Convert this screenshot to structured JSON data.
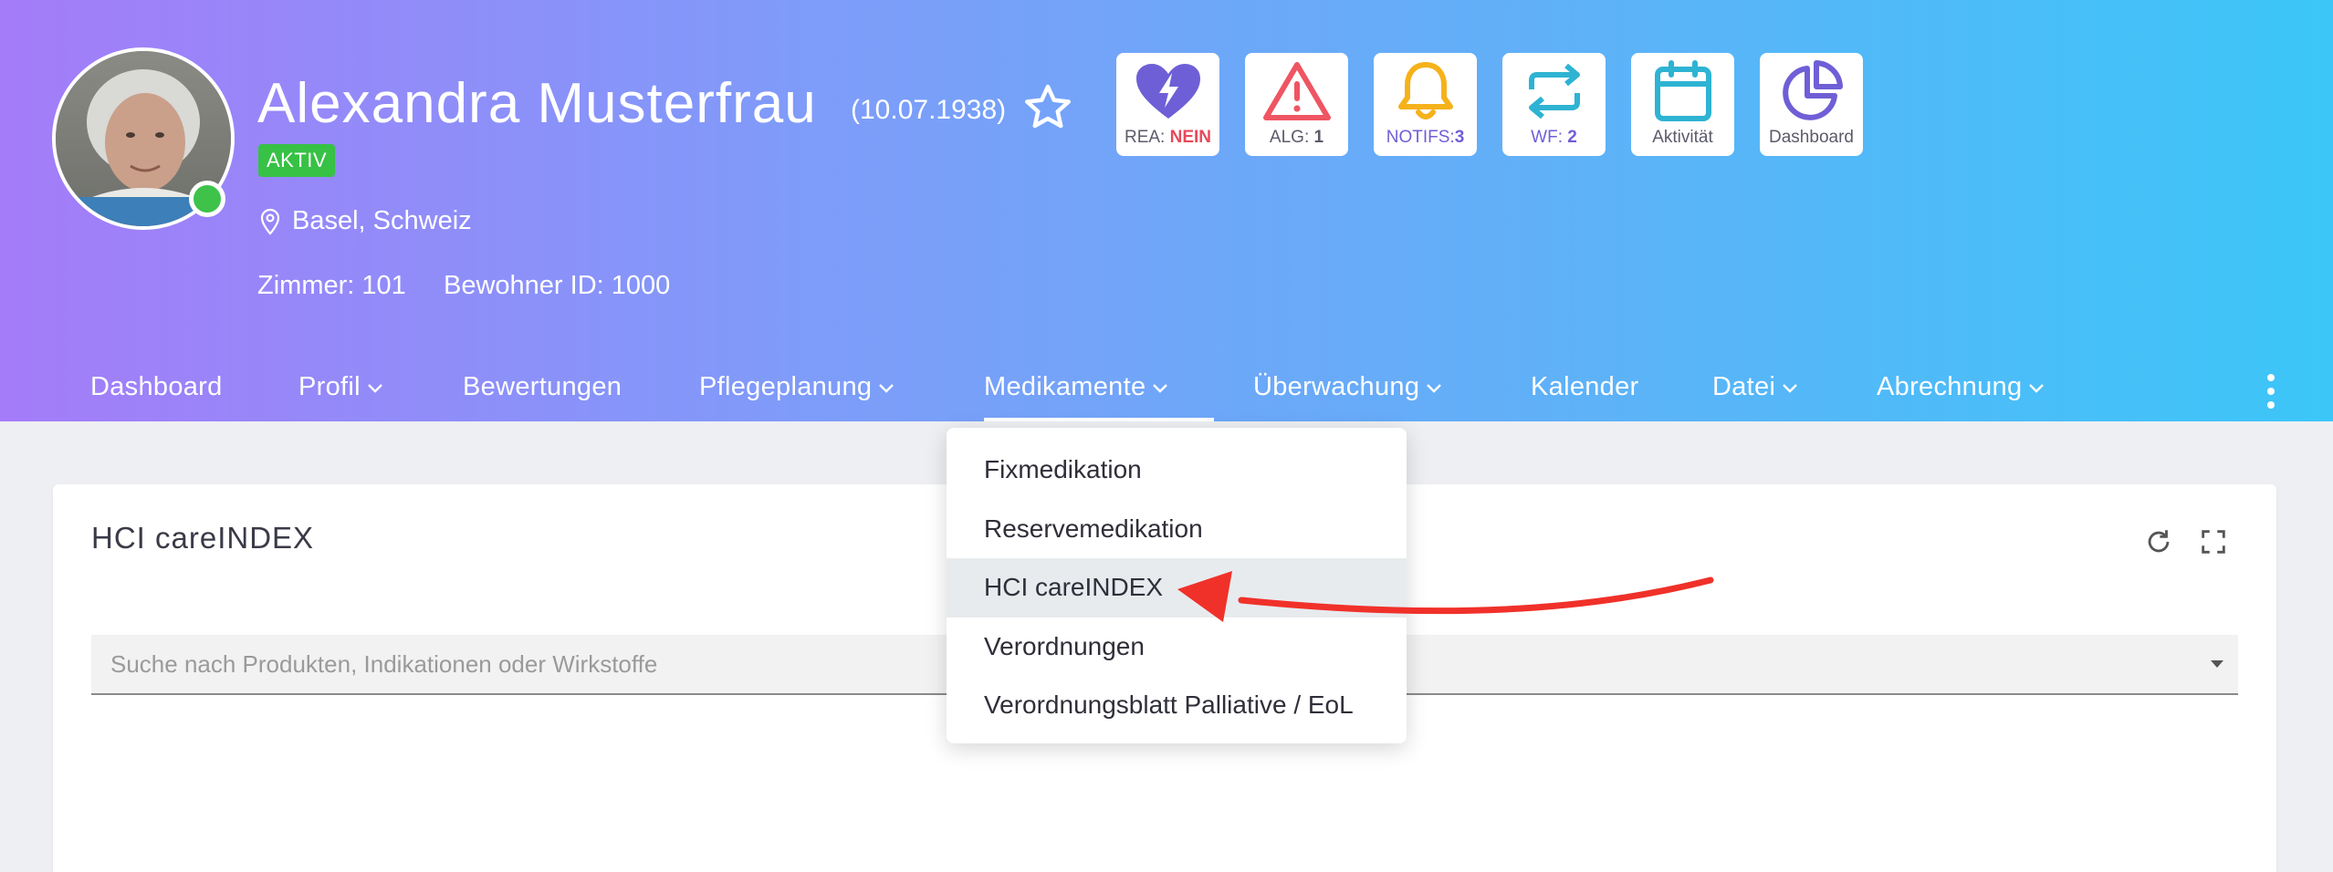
{
  "patient": {
    "name": "Alexandra Musterfrau",
    "dob": "(10.07.1938)",
    "status": "AKTIV",
    "location": "Basel, Schweiz",
    "room": "Zimmer: 101",
    "resident_id": "Bewohner ID: 1000"
  },
  "tiles": [
    {
      "icon": "heart-bolt-icon",
      "label_prefix": "REA: ",
      "label_value": "NEIN",
      "icon_color": "#6f5fd6",
      "value_color": "#e64a5a"
    },
    {
      "icon": "warning-triangle-icon",
      "label_prefix": "ALG: ",
      "label_value": "1",
      "icon_color": "#ef5563",
      "value_color": "#5b5b6b"
    },
    {
      "icon": "bell-icon",
      "label_prefix": "NOTIFS:",
      "label_value": "3",
      "icon_color": "#f6b21b",
      "value_color": "#6f5fd6"
    },
    {
      "icon": "repeat-arrows-icon",
      "label_prefix": "WF: ",
      "label_value": "2",
      "icon_color": "#2eb3d3",
      "value_color": "#6f5fd6"
    },
    {
      "icon": "calendar-icon",
      "label_prefix": "Aktivität",
      "label_value": "",
      "icon_color": "#2eb3d3",
      "value_color": "#5b5b6b"
    },
    {
      "icon": "pie-chart-icon",
      "label_prefix": "Dashboard",
      "label_value": "",
      "icon_color": "#6f5fd6",
      "value_color": "#5b5b6b"
    }
  ],
  "nav": [
    {
      "label": "Dashboard",
      "has_caret": false
    },
    {
      "label": "Profil",
      "has_caret": true
    },
    {
      "label": "Bewertungen",
      "has_caret": false
    },
    {
      "label": "Pflegeplanung",
      "has_caret": true
    },
    {
      "label": "Medikamente",
      "has_caret": true,
      "active": true
    },
    {
      "label": "Überwachung",
      "has_caret": true
    },
    {
      "label": "Kalender",
      "has_caret": false
    },
    {
      "label": "Datei",
      "has_caret": true
    },
    {
      "label": "Abrechnung",
      "has_caret": true
    }
  ],
  "card": {
    "title": "HCI careINDEX",
    "search_placeholder": "Suche nach Produkten, Indikationen oder Wirkstoffe"
  },
  "dropdown": {
    "items": [
      {
        "label": "Fixmedikation",
        "active": false
      },
      {
        "label": "Reservemedikation",
        "active": false
      },
      {
        "label": "HCI careINDEX",
        "active": true
      },
      {
        "label": "Verordnungen",
        "active": false
      },
      {
        "label": "Verordnungsblatt Palliative / EoL",
        "active": false
      }
    ]
  },
  "colors": {
    "header_gradient": [
      "#a47cf9",
      "#3cc6f8"
    ],
    "status_green": "#37c145",
    "annotation_arrow": "#f0312a"
  }
}
